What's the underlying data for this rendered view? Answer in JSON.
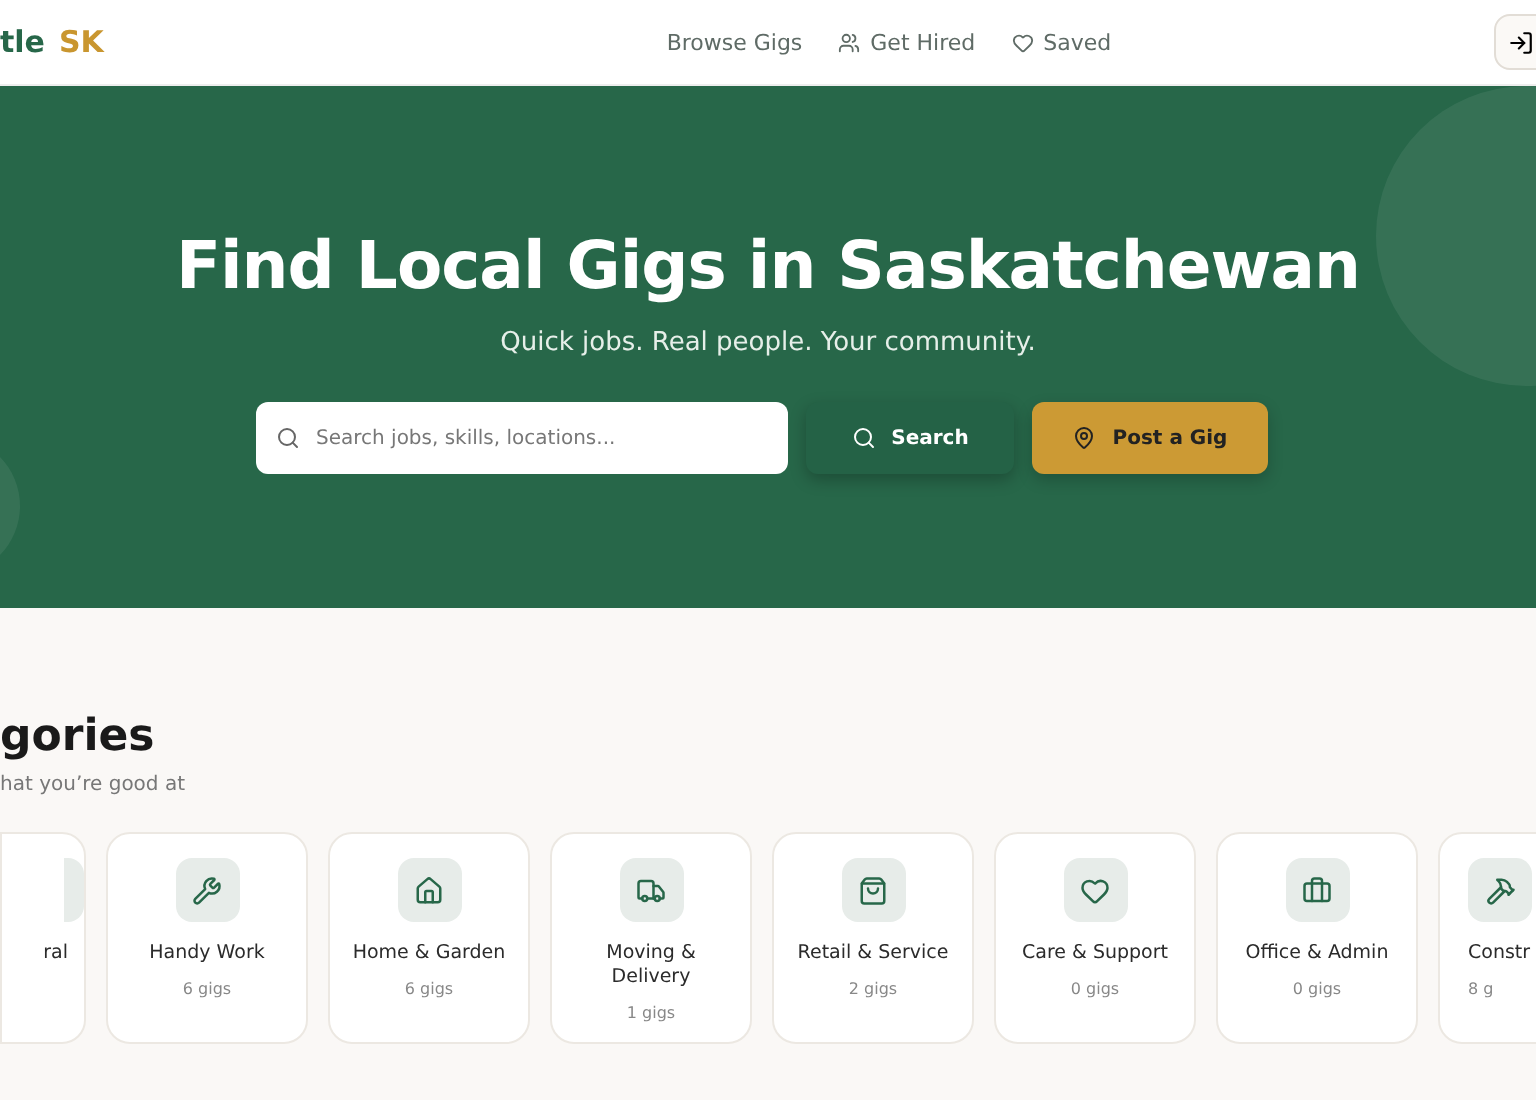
{
  "nav": {
    "logo_main": "tle",
    "logo_accent": "SK",
    "links": [
      {
        "label": "Browse Gigs"
      },
      {
        "label": "Get Hired"
      },
      {
        "label": "Saved"
      }
    ]
  },
  "hero": {
    "title": "Find Local Gigs in Saskatchewan",
    "subtitle": "Quick jobs. Real people. Your community.",
    "search": {
      "placeholder": "Search jobs, skills, locations..."
    },
    "search_button": "Search",
    "post_button": "Post a Gig"
  },
  "categories": {
    "title": "gories",
    "subtitle": "hat you’re good at",
    "items": [
      {
        "name": "ral",
        "kind": "clipped-left"
      },
      {
        "name": "Handy Work",
        "count": "6 gigs",
        "kind": "full"
      },
      {
        "name": "Home & Garden",
        "count": "6 gigs",
        "kind": "full"
      },
      {
        "name": "Moving & Delivery",
        "count": "1 gigs",
        "kind": "full"
      },
      {
        "name": "Retail & Service",
        "count": "2 gigs",
        "kind": "full"
      },
      {
        "name": "Care & Support",
        "count": "0 gigs",
        "kind": "full"
      },
      {
        "name": "Office & Admin",
        "count": "0 gigs",
        "kind": "full"
      },
      {
        "name": "Constr",
        "count": "8 g",
        "kind": "clipped-right"
      }
    ]
  }
}
